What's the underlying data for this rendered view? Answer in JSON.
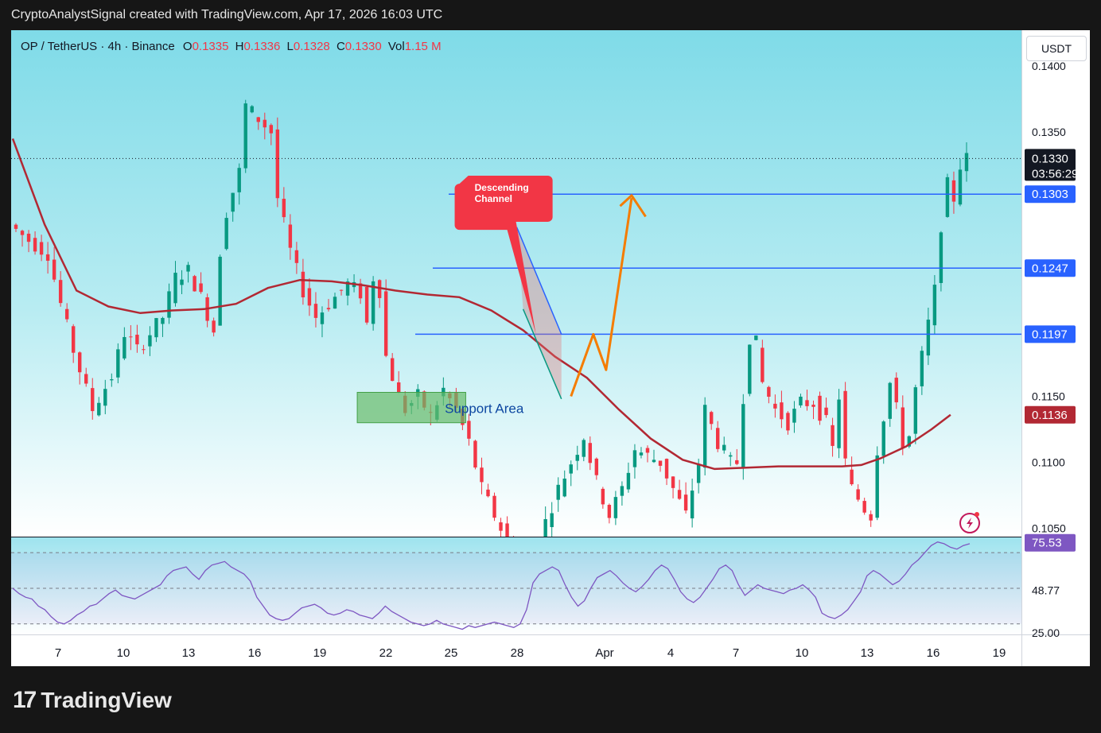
{
  "caption": "CryptoAnalystSignal created with TradingView.com, Apr 17, 2026 16:03 UTC",
  "header": {
    "symbol": "OP / TetherUS · 4h · Binance",
    "o_label": "O",
    "o_value": "0.1335",
    "h_label": "H",
    "h_value": "0.1336",
    "l_label": "L",
    "l_value": "0.1328",
    "c_label": "C",
    "c_value": "0.1330",
    "vol_label": "Vol",
    "vol_value": "1.15 M"
  },
  "currency_button": "USDT",
  "footer": {
    "brand": "TradingView",
    "mark": "17"
  },
  "colors": {
    "up": "#089981",
    "down": "#f23645",
    "ma": "#b22833",
    "level": "#2962ff",
    "arrow": "#f57c00",
    "rsi": "#7e57c2",
    "channel_label_bg": "#f23645",
    "support_fill": "#66bb6a",
    "bg_top": "#7fdbe8",
    "bg_bottom": "#ffffff"
  },
  "chart_data": [
    {
      "type": "candlestick",
      "series_name": "OP / TetherUS · 4h · Binance",
      "ylim": [
        0.1045,
        0.14
      ],
      "y_ticks": [
        "0.1400",
        "0.1350",
        "0.1150",
        "0.1100",
        "0.1050"
      ],
      "x_ticks": [
        "7",
        "10",
        "13",
        "16",
        "19",
        "22",
        "25",
        "28",
        "Apr",
        "4",
        "7",
        "10",
        "13",
        "16",
        "19"
      ],
      "price_path": [
        [
          0,
          0.128
        ],
        [
          3,
          0.1268
        ],
        [
          6,
          0.1258
        ],
        [
          8,
          0.122
        ],
        [
          10,
          0.1185
        ],
        [
          13,
          0.114
        ],
        [
          16,
          0.1165
        ],
        [
          18,
          0.1198
        ],
        [
          20,
          0.1185
        ],
        [
          24,
          0.121
        ],
        [
          26,
          0.124
        ],
        [
          28,
          0.1245
        ],
        [
          30,
          0.1225
        ],
        [
          32,
          0.12
        ],
        [
          33,
          0.126
        ],
        [
          34,
          0.129
        ],
        [
          36,
          0.132
        ],
        [
          37,
          0.137
        ],
        [
          39,
          0.136
        ],
        [
          41,
          0.135
        ],
        [
          42,
          0.13
        ],
        [
          44,
          0.126
        ],
        [
          46,
          0.123
        ],
        [
          48,
          0.121
        ],
        [
          51,
          0.1225
        ],
        [
          53,
          0.1235
        ],
        [
          55,
          0.1228
        ],
        [
          56,
          0.1205
        ],
        [
          57,
          0.124
        ],
        [
          58,
          0.123
        ],
        [
          59,
          0.118
        ],
        [
          60,
          0.1165
        ],
        [
          61,
          0.115
        ],
        [
          62,
          0.114
        ],
        [
          64,
          0.115
        ],
        [
          66,
          0.1135
        ],
        [
          68,
          0.1155
        ],
        [
          70,
          0.114
        ],
        [
          72,
          0.1115
        ],
        [
          74,
          0.108
        ],
        [
          76,
          0.106
        ],
        [
          78,
          0.104
        ],
        [
          80,
          0.103
        ],
        [
          82,
          0.1
        ],
        [
          84,
          0.1055
        ],
        [
          86,
          0.108
        ],
        [
          88,
          0.11
        ],
        [
          90,
          0.112
        ],
        [
          92,
          0.1085
        ],
        [
          94,
          0.106
        ],
        [
          96,
          0.108
        ],
        [
          98,
          0.111
        ],
        [
          100,
          0.1105
        ],
        [
          102,
          0.11
        ],
        [
          104,
          0.108
        ],
        [
          106,
          0.106
        ],
        [
          108,
          0.11
        ],
        [
          109,
          0.114
        ],
        [
          111,
          0.1115
        ],
        [
          113,
          0.11
        ],
        [
          114,
          0.11
        ],
        [
          115,
          0.115
        ],
        [
          116,
          0.1195
        ],
        [
          117,
          0.119
        ],
        [
          118,
          0.116
        ],
        [
          120,
          0.114
        ],
        [
          122,
          0.113
        ],
        [
          124,
          0.1145
        ],
        [
          126,
          0.1145
        ],
        [
          128,
          0.113
        ],
        [
          129,
          0.111
        ],
        [
          130,
          0.115
        ],
        [
          131,
          0.11
        ],
        [
          132,
          0.108
        ],
        [
          134,
          0.1065
        ],
        [
          135,
          0.106
        ],
        [
          136,
          0.111
        ],
        [
          138,
          0.116
        ],
        [
          139,
          0.114
        ],
        [
          140,
          0.1115
        ],
        [
          141,
          0.112
        ],
        [
          142,
          0.1155
        ],
        [
          143,
          0.118
        ],
        [
          144,
          0.1205
        ],
        [
          145,
          0.123
        ],
        [
          146,
          0.128
        ],
        [
          147,
          0.131
        ],
        [
          148,
          0.13
        ],
        [
          149,
          0.1325
        ],
        [
          150,
          0.133
        ]
      ],
      "ma_path": [
        [
          0,
          0.1345
        ],
        [
          5,
          0.128
        ],
        [
          10,
          0.123
        ],
        [
          15,
          0.1218
        ],
        [
          20,
          0.1213
        ],
        [
          25,
          0.1215
        ],
        [
          30,
          0.1216
        ],
        [
          35,
          0.122
        ],
        [
          40,
          0.1232
        ],
        [
          45,
          0.1238
        ],
        [
          50,
          0.1237
        ],
        [
          55,
          0.1234
        ],
        [
          60,
          0.123
        ],
        [
          65,
          0.1227
        ],
        [
          70,
          0.1225
        ],
        [
          75,
          0.1215
        ],
        [
          80,
          0.12
        ],
        [
          85,
          0.118
        ],
        [
          90,
          0.1164
        ],
        [
          95,
          0.114
        ],
        [
          100,
          0.1118
        ],
        [
          105,
          0.1102
        ],
        [
          110,
          0.1095
        ],
        [
          115,
          0.1096
        ],
        [
          120,
          0.1097
        ],
        [
          125,
          0.1097
        ],
        [
          130,
          0.1097
        ],
        [
          133,
          0.1098
        ],
        [
          136,
          0.1103
        ],
        [
          140,
          0.1112
        ],
        [
          144,
          0.1125
        ],
        [
          147,
          0.1136
        ]
      ],
      "horizontal_levels": [
        0.1303,
        0.1247,
        0.1197
      ],
      "price_labels": [
        {
          "value": 0.133,
          "text": "0.1330",
          "countdown": "03:56:29"
        },
        {
          "value": 0.1303,
          "text": "0.1303"
        },
        {
          "value": 0.1247,
          "text": "0.1247"
        },
        {
          "value": 0.1197,
          "text": "0.1197"
        },
        {
          "value": 0.1136,
          "text": "0.1136"
        }
      ],
      "annotations": {
        "descending_channel": "Descending\nChannel",
        "support_area": "Support Area"
      }
    },
    {
      "type": "line",
      "series_name": "RSI",
      "ylim": [
        25.0,
        79.43
      ],
      "y_ticks": [
        "79.43",
        "48.77",
        "25.00"
      ],
      "current_value": "75.53",
      "levels": [
        70,
        50,
        30
      ],
      "values": [
        50,
        47,
        45,
        44,
        40,
        38,
        34,
        31,
        30,
        32,
        35,
        37,
        40,
        41,
        44,
        47,
        49,
        46,
        45,
        44,
        46,
        48,
        50,
        52,
        57,
        60,
        61,
        62,
        58,
        55,
        60,
        63,
        64,
        65,
        62,
        60,
        58,
        54,
        45,
        40,
        35,
        33,
        32,
        33,
        36,
        39,
        40,
        41,
        39,
        36,
        35,
        36,
        38,
        37,
        35,
        34,
        33,
        36,
        40,
        37,
        35,
        33,
        31,
        30,
        29,
        30,
        32,
        30,
        29,
        28,
        27,
        29,
        28,
        29,
        30,
        31,
        30,
        29,
        28,
        30,
        38,
        53,
        58,
        60,
        62,
        60,
        52,
        45,
        40,
        43,
        50,
        56,
        58,
        60,
        57,
        53,
        50,
        48,
        51,
        55,
        60,
        63,
        61,
        55,
        48,
        44,
        42,
        45,
        50,
        55,
        61,
        63,
        60,
        52,
        46,
        49,
        52,
        50,
        49,
        48,
        47,
        49,
        50,
        52,
        49,
        45,
        36,
        34,
        33,
        35,
        38,
        43,
        48,
        57,
        60,
        58,
        55,
        52,
        54,
        58,
        63,
        66,
        70,
        74,
        76,
        75,
        73,
        72,
        74,
        75
      ]
    }
  ]
}
